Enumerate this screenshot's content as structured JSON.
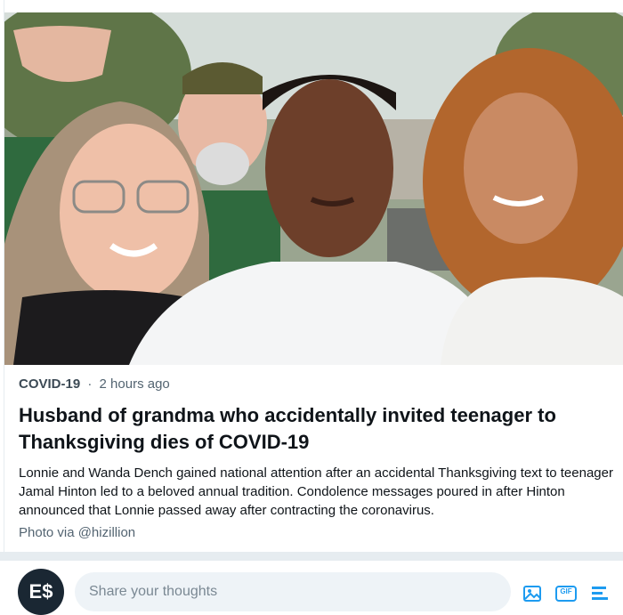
{
  "article": {
    "category": "COVID-19",
    "separator": "·",
    "time": "2 hours ago",
    "headline": "Husband of grandma who accidentally invited teenager to Thanksgiving dies of COVID-19",
    "summary": "Lonnie and Wanda Dench gained national attention after an accidental Thanksgiving text to teenager Jamal Hinton led to a beloved annual tradition. Condolence messages poured in after Hinton announced that Lonnie passed away after contracting the coronavirus.",
    "credit": "Photo via @hizillion"
  },
  "composer": {
    "avatar_text": "E$",
    "placeholder": "Share your thoughts",
    "tools": [
      "image-icon",
      "gif-icon",
      "poll-icon"
    ],
    "gif_label": "GIF"
  },
  "colors": {
    "accent": "#1d9bf0",
    "divider": "#e6ecf0",
    "input_bg": "#eef3f7"
  }
}
